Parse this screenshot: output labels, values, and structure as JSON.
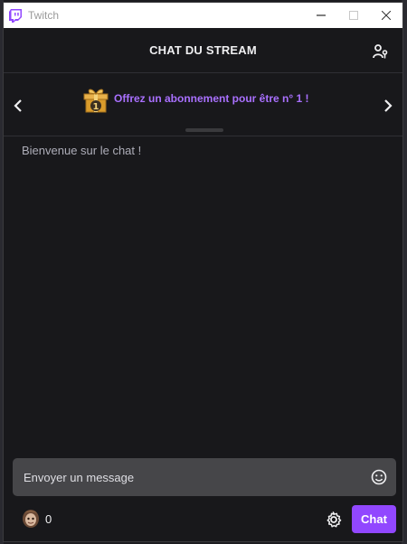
{
  "window": {
    "title": "Twitch"
  },
  "header": {
    "title": "CHAT DU STREAM"
  },
  "banner": {
    "promo_text": "Offrez un abonnement pour être n° 1 !",
    "gift_badge_number": "1"
  },
  "chat": {
    "welcome_message": "Bienvenue sur le chat !"
  },
  "composer": {
    "placeholder": "Envoyer un message"
  },
  "footer": {
    "points_count": "0",
    "chat_button_label": "Chat"
  },
  "colors": {
    "accent": "#9147ff",
    "promo_text": "#a970ff",
    "background": "#18181b"
  },
  "icons": [
    "twitch-logo-icon",
    "minimize-icon",
    "maximize-icon",
    "close-icon",
    "community-icon",
    "chevron-left-icon",
    "chevron-right-icon",
    "gift-icon",
    "emote-icon",
    "gear-icon",
    "channel-points-icon"
  ]
}
